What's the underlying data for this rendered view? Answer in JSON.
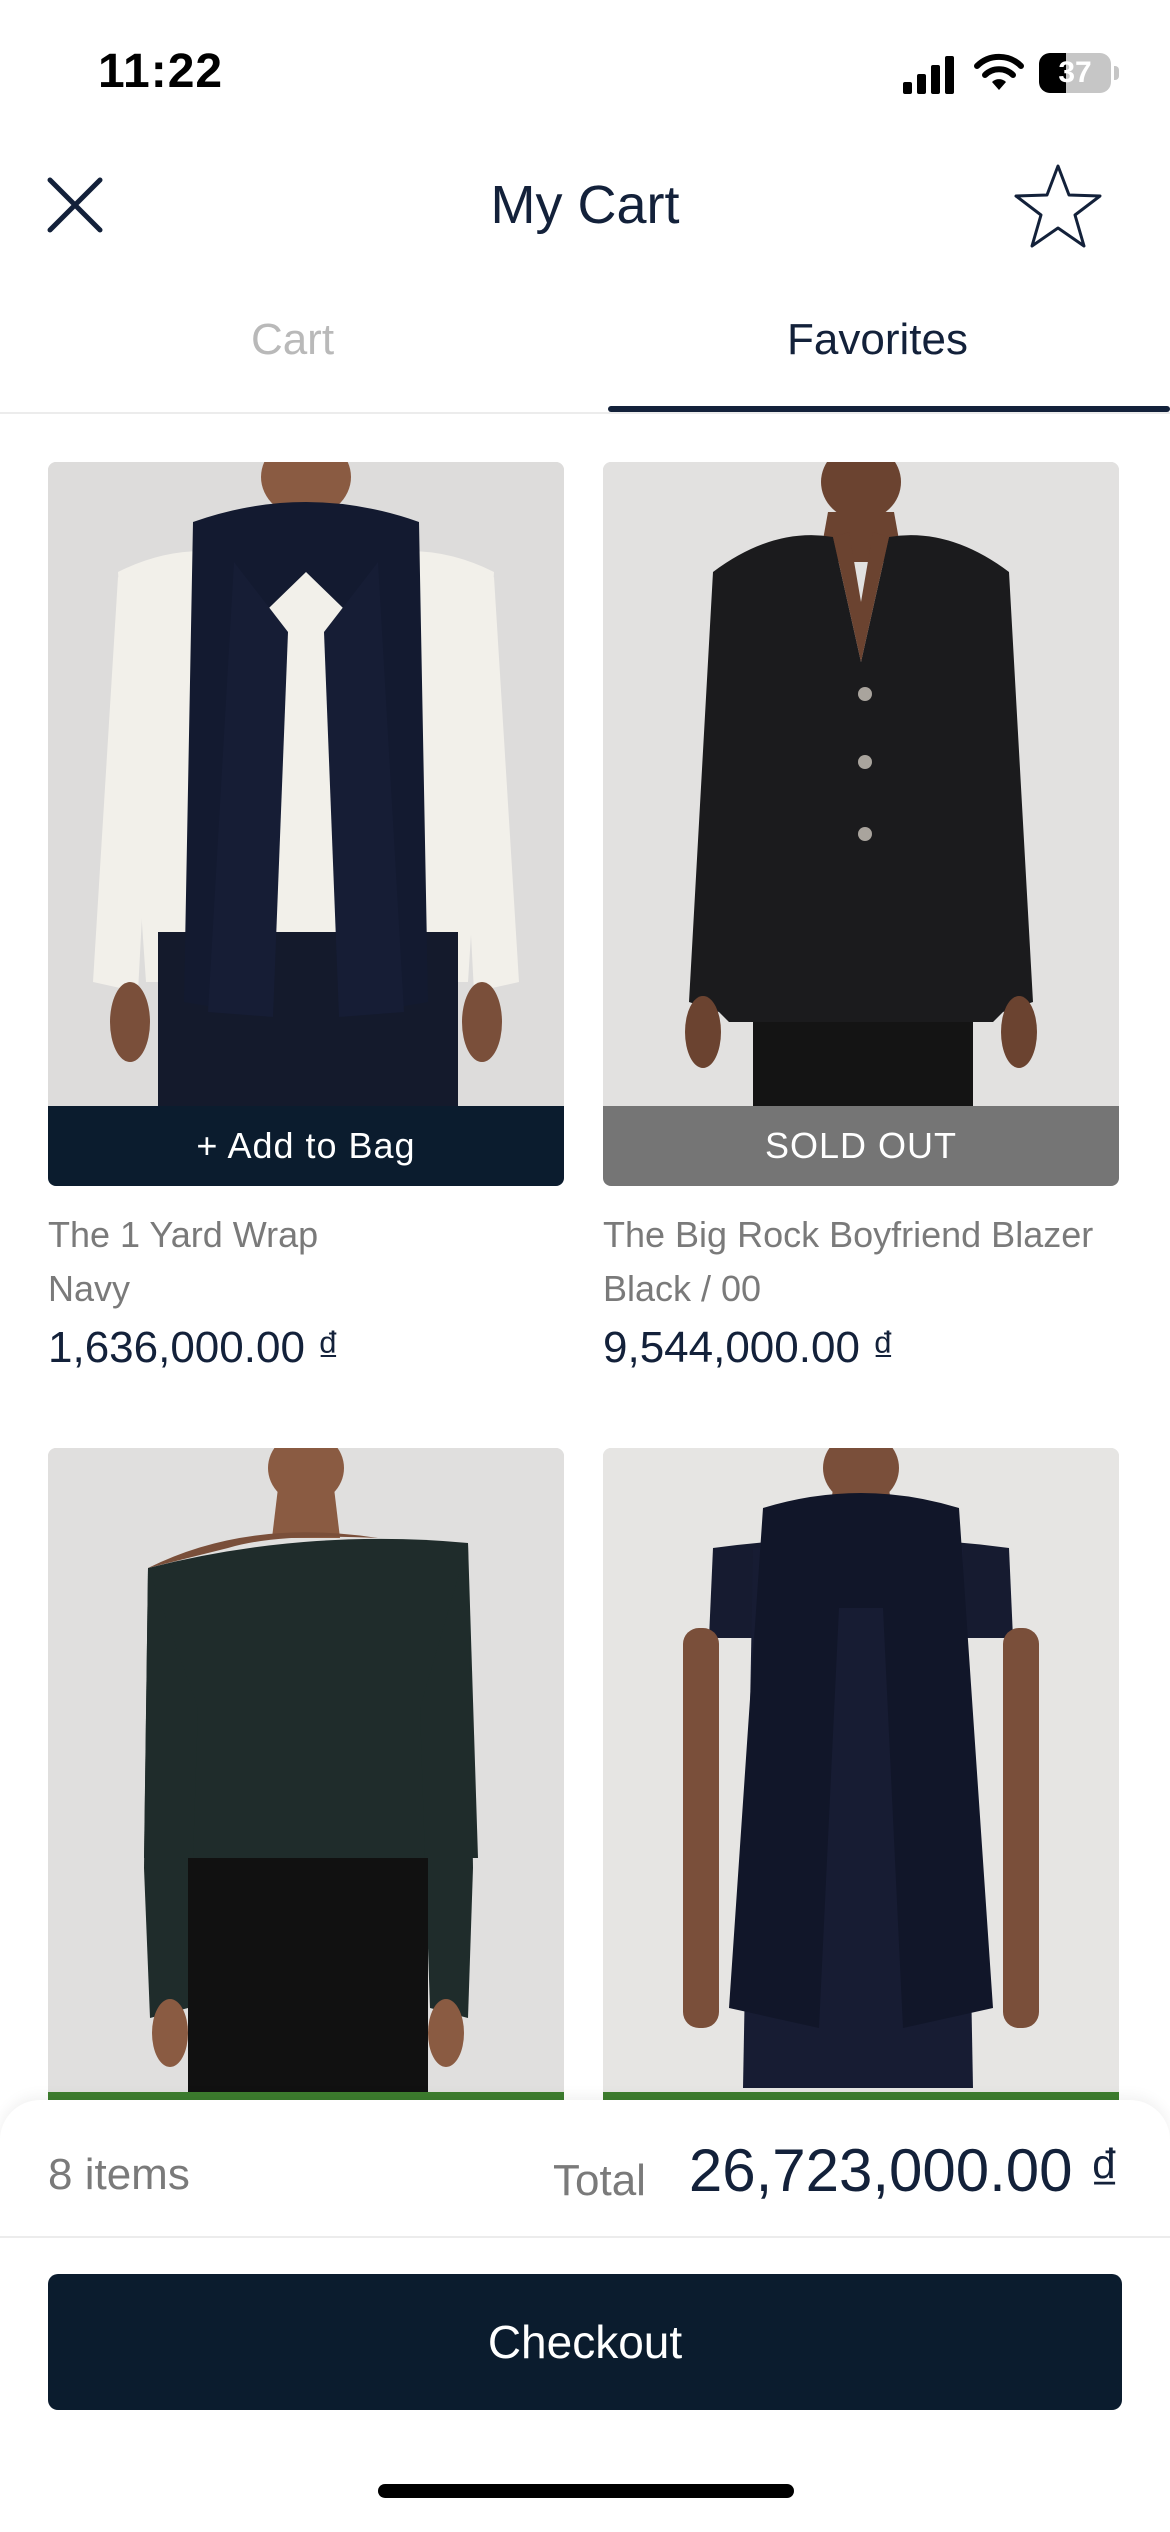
{
  "status_bar": {
    "time": "11:22",
    "battery": "37",
    "battery_level": 0.37
  },
  "header": {
    "title": "My Cart",
    "close_icon": "close-icon",
    "favorite_icon": "star-icon"
  },
  "tabs": [
    {
      "label": "Cart",
      "active": false
    },
    {
      "label": "Favorites",
      "active": true
    }
  ],
  "products": [
    {
      "name": "The 1 Yard Wrap",
      "variant": "Navy",
      "price": "1,636,000.00 ₫",
      "action": "+ Add to Bag",
      "action_type": "add"
    },
    {
      "name": "The Big Rock Boyfriend Blazer",
      "variant": "Black / 00",
      "price": "9,544,000.00 ₫",
      "action": "SOLD OUT",
      "action_type": "soldout"
    }
  ],
  "summary": {
    "items_count": "8 items",
    "total_label": "Total",
    "total_value": "26,723,000.00 ₫",
    "checkout_label": "Checkout"
  },
  "colors": {
    "primary": "#0b1c2e",
    "soldout": "#757575",
    "accent_green": "#3d7d2e",
    "muted_text": "#7a7a7a"
  }
}
